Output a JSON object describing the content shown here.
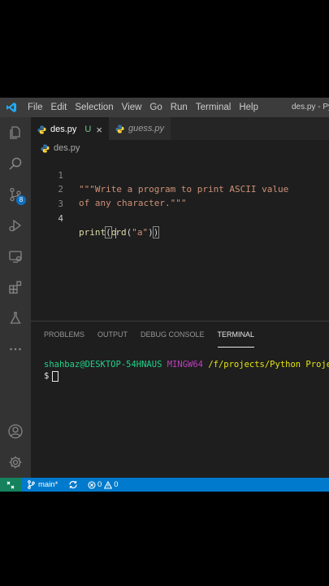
{
  "titlebar": {
    "menu": [
      "File",
      "Edit",
      "Selection",
      "View",
      "Go",
      "Run",
      "Terminal",
      "Help"
    ],
    "window_title": "des.py - Py"
  },
  "activity": {
    "scm_badge": "8"
  },
  "tabs": [
    {
      "label": "des.py",
      "status": "U",
      "close": "×"
    },
    {
      "label": "guess.py"
    }
  ],
  "breadcrumb": {
    "file": "des.py"
  },
  "editor": {
    "line_numbers": [
      "1",
      "2",
      "3",
      "4"
    ],
    "line1": "\"\"\"Write a program to print ASCII value",
    "line2": "of any character.\"\"\"",
    "line4": {
      "fn": "print",
      "open": "(",
      "inner_fn_a": "o",
      "inner_fn_b": "rd",
      "inner_open": "(",
      "arg": "\"a\"",
      "inner_close": ")",
      "close": ")"
    }
  },
  "panel": {
    "tabs": [
      "PROBLEMS",
      "OUTPUT",
      "DEBUG CONSOLE",
      "TERMINAL"
    ],
    "terminal": {
      "user": "shahbaz@DESKTOP-54HNAUS",
      "env": "MINGW64",
      "path": "/f/projects/Python Projects",
      "prompt": "$"
    }
  },
  "statusbar": {
    "branch": "main*",
    "errors": "0",
    "warnings": "0"
  },
  "colors": {
    "accent": "#007acc",
    "remote": "#16825d",
    "python_blue": "#3572A5",
    "python_yellow": "#ffd43b"
  }
}
